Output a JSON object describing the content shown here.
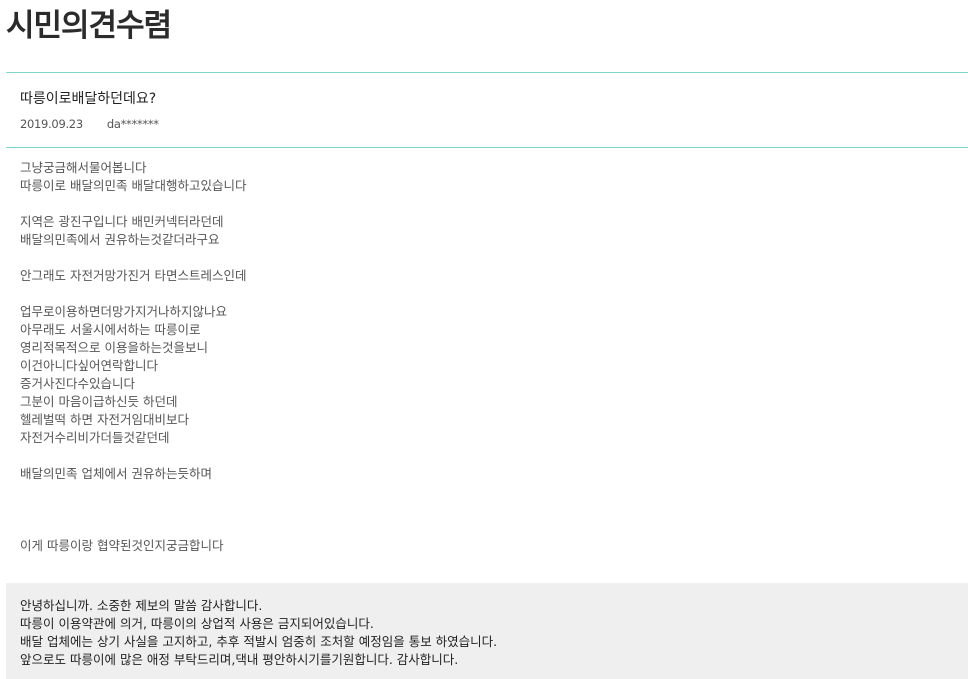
{
  "page": {
    "title": "시민의견수렴"
  },
  "post": {
    "title": "따릉이로배달하던데요?",
    "date": "2019.09.23",
    "author": "da*******",
    "body_lines": [
      "그냥궁금해서물어봅니다",
      "따릉이로 배달의민족 배달대행하고있습니다",
      "",
      "지역은 광진구입니다 배민커넥터라던데",
      "배달의민족에서 권유하는것같더라구요",
      "",
      "안그래도 자전거망가진거 타면스트레스인데",
      "",
      "업무로이용하면더망가지거나하지않나요",
      "아무래도 서울시에서하는 따릉이로",
      "영리적목적으로 이용을하는것을보니",
      "이건아니다싶어연락합니다",
      "증거사진다수있습니다",
      "그분이 마음이급하신듯 하던데",
      "헬레벌떡 하면 자전거임대비보다",
      "자전거수리비가더들것같던데",
      "",
      "배달의민족 업체에서 권유하는듯하며",
      "",
      "",
      "",
      "이게 따릉이랑 협약된것인지궁금합니다"
    ]
  },
  "reply": {
    "lines": [
      "안녕하십니까. 소중한 제보의 말씀 감사합니다.",
      "따릉이 이용약관에 의거, 따릉이의 상업적 사용은 금지되어있습니다.",
      "배달 업체에는 상기 사실을 고지하고, 추후 적발시 엄중히 조처할 예정임을 통보 하였습니다.",
      "앞으로도 따릉이에 많은 애정 부탁드리며,댁내 평안하시기를기원합니다. 감사합니다."
    ]
  }
}
